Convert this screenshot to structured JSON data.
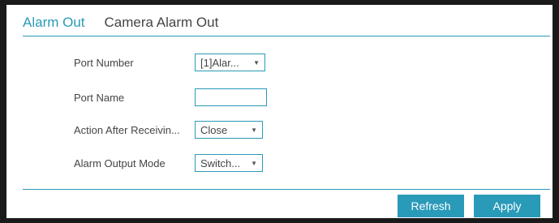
{
  "tabs": [
    {
      "label": "Alarm Out",
      "active": true
    },
    {
      "label": "Camera Alarm Out",
      "active": false
    }
  ],
  "form": {
    "port_number": {
      "label": "Port Number",
      "value": "[1]Alar..."
    },
    "port_name": {
      "label": "Port Name",
      "value": ""
    },
    "action_after_receiving": {
      "label": "Action After Receivin...",
      "value": "Close"
    },
    "alarm_output_mode": {
      "label": "Alarm Output Mode",
      "value": "Switch..."
    }
  },
  "buttons": {
    "refresh_label": "Refresh",
    "apply_label": "Apply"
  },
  "colors": {
    "accent": "#2a9ab9",
    "frame": "#1a1a1a"
  },
  "icons": {
    "dropdown": "chevron-down-icon"
  }
}
